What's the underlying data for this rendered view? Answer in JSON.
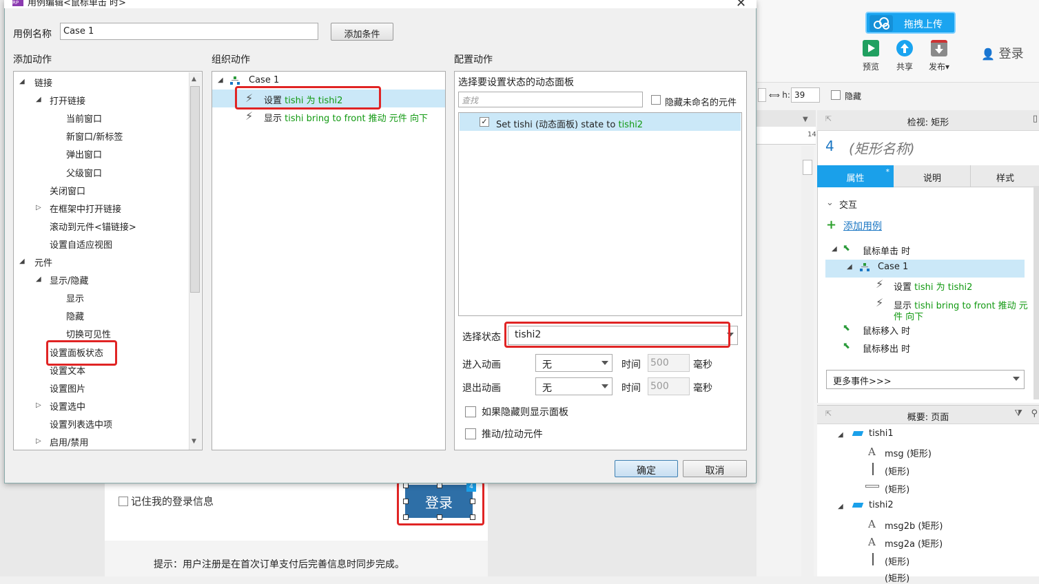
{
  "dialog": {
    "title": "用例编辑<鼠标单击 时>",
    "title_icon": "RP",
    "case_name_label": "用例名称",
    "case_name_value": "Case 1",
    "add_condition": "添加条件",
    "add_action_title": "添加动作",
    "organize_title": "组织动作",
    "config_title": "配置动作",
    "actions_tree": [
      {
        "label": "链接",
        "level": 0,
        "exp": "open"
      },
      {
        "label": "打开链接",
        "level": 1,
        "exp": "open"
      },
      {
        "label": "当前窗口",
        "level": 2,
        "exp": ""
      },
      {
        "label": "新窗口/新标签",
        "level": 2,
        "exp": ""
      },
      {
        "label": "弹出窗口",
        "level": 2,
        "exp": ""
      },
      {
        "label": "父级窗口",
        "level": 2,
        "exp": ""
      },
      {
        "label": "关闭窗口",
        "level": 1,
        "exp": ""
      },
      {
        "label": "在框架中打开链接",
        "level": 1,
        "exp": "closed"
      },
      {
        "label": "滚动到元件<锚链接>",
        "level": 1,
        "exp": ""
      },
      {
        "label": "设置自适应视图",
        "level": 1,
        "exp": ""
      },
      {
        "label": "元件",
        "level": 0,
        "exp": "open"
      },
      {
        "label": "显示/隐藏",
        "level": 1,
        "exp": "open"
      },
      {
        "label": "显示",
        "level": 2,
        "exp": ""
      },
      {
        "label": "隐藏",
        "level": 2,
        "exp": ""
      },
      {
        "label": "切换可见性",
        "level": 2,
        "exp": ""
      },
      {
        "label": "设置面板状态",
        "level": 1,
        "exp": ""
      },
      {
        "label": "设置文本",
        "level": 1,
        "exp": ""
      },
      {
        "label": "设置图片",
        "level": 1,
        "exp": ""
      },
      {
        "label": "设置选中",
        "level": 1,
        "exp": "closed"
      },
      {
        "label": "设置列表选中项",
        "level": 1,
        "exp": ""
      },
      {
        "label": "启用/禁用",
        "level": 1,
        "exp": "closed"
      }
    ],
    "organize": {
      "case_label": "Case 1",
      "action1_prefix": "设置 ",
      "action1_green": "tishi 为 tishi2",
      "action2_prefix": "显示 ",
      "action2_green": "tishi bring to front 推动 元件 向下"
    },
    "config": {
      "panel_title": "选择要设置状态的动态面板",
      "search_placeholder": "查找",
      "hide_unnamed": "隐藏未命名的元件",
      "row_text": "Set tishi (动态面板) state to ",
      "row_green": "tishi2",
      "select_state_label": "选择状态",
      "select_state_value": "tishi2",
      "enter_anim_label": "进入动画",
      "exit_anim_label": "退出动画",
      "anim_value": "无",
      "time_label": "时间",
      "time_value": "500",
      "ms_label": "毫秒",
      "show_if_hidden": "如果隐藏则显示面板",
      "push_widgets": "推动/拉动元件"
    },
    "ok": "确定",
    "cancel": "取消"
  },
  "toolbar": {
    "upload": "拖拽上传",
    "preview": "预览",
    "share": "共享",
    "publish": "发布▾",
    "login": "登录",
    "h_label": "h:",
    "h_value": "39",
    "hide_label": "隐藏"
  },
  "ruler": {
    "mark": "14"
  },
  "inspector": {
    "title": "检视: 矩形",
    "number": "4",
    "name_placeholder": "(矩形名称)",
    "tabs": [
      "属性",
      "说明",
      "样式"
    ],
    "tab_star": "*",
    "section": "交互",
    "add_case": "添加用例",
    "events": {
      "click": "鼠标单击 时",
      "case": "Case 1",
      "a1_prefix": "设置 ",
      "a1_green": "tishi 为 tishi2",
      "a2_prefix": "显示 ",
      "a2_green_line1": "tishi bring to front 推动 元",
      "a2_green_line2": "件 向下",
      "hover_in": "鼠标移入 时",
      "hover_out": "鼠标移出 时"
    },
    "more_events": "更多事件>>>"
  },
  "outline": {
    "title": "概要: 页面",
    "items": [
      {
        "label": "tishi1",
        "type": "panel"
      },
      {
        "label": "msg (矩形)",
        "type": "text"
      },
      {
        "label": "(矩形)",
        "type": "line"
      },
      {
        "label": "(矩形)",
        "type": "rect"
      },
      {
        "label": "tishi2",
        "type": "panel"
      },
      {
        "label": "msg2b (矩形)",
        "type": "text"
      },
      {
        "label": "msg2a (矩形)",
        "type": "text"
      },
      {
        "label": "(矩形)",
        "type": "line"
      },
      {
        "label": "(矩形)",
        "type": "line"
      }
    ]
  },
  "canvas": {
    "remember": "记住我的登录信息",
    "login_button": "登录",
    "badge": "4",
    "tip": "提示：用户注册是在首次订单支付后完善信息时同步完成。"
  }
}
